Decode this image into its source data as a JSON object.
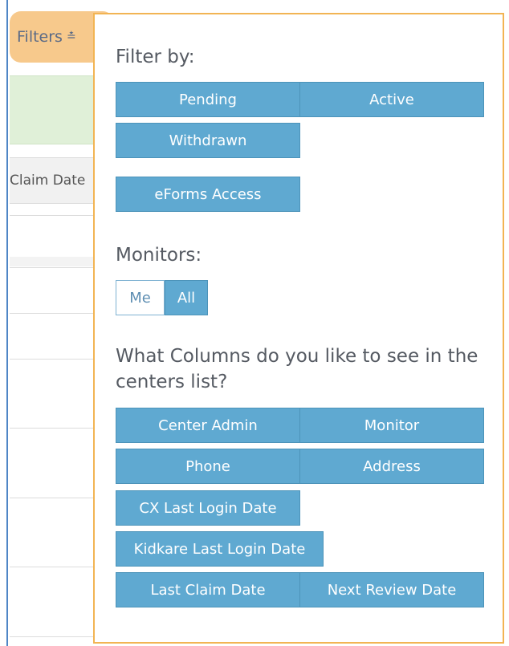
{
  "background": {
    "filters_label": "Filters",
    "column_header": "Claim Date"
  },
  "filter_by": {
    "title": "Filter by:",
    "options": [
      "Pending",
      "Active",
      "Withdrawn"
    ],
    "eforms_access": "eForms Access"
  },
  "monitors": {
    "title": "Monitors:",
    "options": [
      "Me",
      "All"
    ],
    "selected": "All"
  },
  "columns": {
    "title": "What Columns do you like to see in the centers list?",
    "options": [
      "Center Admin",
      "Monitor",
      "Phone",
      "Address",
      "CX Last Login Date",
      "Kidkare Last Login Date",
      "Last Claim Date",
      "Next Review Date"
    ]
  },
  "colors": {
    "button_blue": "#5fa9d1",
    "popover_border": "#f2b453",
    "filters_tab": "#f7c98c"
  }
}
